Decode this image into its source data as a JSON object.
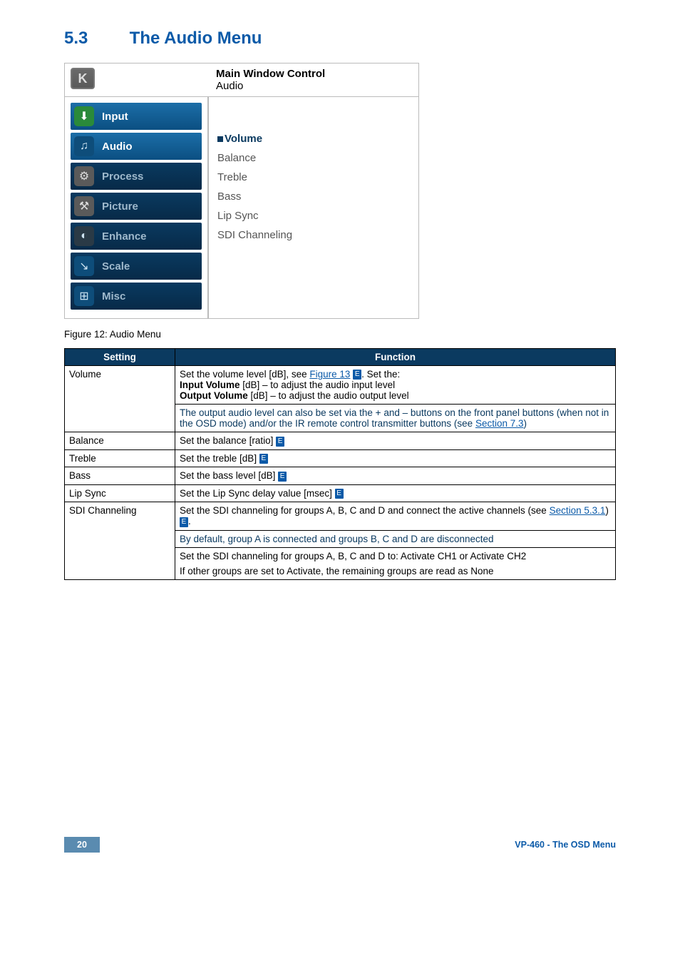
{
  "section": {
    "number": "5.3",
    "title": "The Audio Menu"
  },
  "osd": {
    "header": {
      "line1": "Main Window Control",
      "line2": "Audio"
    },
    "menu": [
      {
        "label": "Input",
        "variant": "light",
        "iconClass": "icon-green",
        "glyph": "⬇",
        "name": "menu-input"
      },
      {
        "label": "Audio",
        "variant": "light",
        "iconClass": "icon-blue",
        "glyph": "♫",
        "name": "menu-audio"
      },
      {
        "label": "Process",
        "variant": "dark",
        "iconClass": "icon-gray",
        "glyph": "⚙",
        "name": "menu-process"
      },
      {
        "label": "Picture",
        "variant": "dark",
        "iconClass": "icon-gray",
        "glyph": "⚒",
        "name": "menu-picture"
      },
      {
        "label": "Enhance",
        "variant": "dark",
        "iconClass": "icon-dark",
        "glyph": "◐",
        "name": "menu-enhance"
      },
      {
        "label": "Scale",
        "variant": "dark",
        "iconClass": "icon-blue",
        "glyph": "↘",
        "name": "menu-scale"
      },
      {
        "label": "Misc",
        "variant": "dark",
        "iconClass": "icon-blue",
        "glyph": "⊞",
        "name": "menu-misc"
      }
    ],
    "content": [
      {
        "label": "Volume",
        "selected": true
      },
      {
        "label": "Balance",
        "selected": false
      },
      {
        "label": "Treble",
        "selected": false
      },
      {
        "label": "Bass",
        "selected": false
      },
      {
        "label": "Lip Sync",
        "selected": false
      },
      {
        "label": "SDI Channeling",
        "selected": false
      }
    ]
  },
  "figure_caption": "Figure 12: Audio Menu",
  "table": {
    "headers": {
      "setting": "Setting",
      "function": "Function"
    },
    "rows": {
      "volume": {
        "setting": "Volume",
        "p1_a": "Set the volume level [dB], see ",
        "p1_link": "Figure 13",
        "p1_b": ". Set the:",
        "p2_bold": "Input Volume",
        "p2_rest": " [dB] – to adjust the audio input level",
        "p3_bold": "Output Volume",
        "p3_rest": " [dB] – to adjust the audio output level",
        "note_a": "The output audio level can also be set via the + and – buttons on the front panel buttons (when not in the OSD mode) and/or the IR remote control transmitter buttons (see ",
        "note_link": "Section 7.3",
        "note_b": ")"
      },
      "balance": {
        "setting": "Balance",
        "func": "Set the balance [ratio] "
      },
      "treble": {
        "setting": "Treble",
        "func": "Set the treble [dB] "
      },
      "bass": {
        "setting": "Bass",
        "func": "Set the bass level [dB] "
      },
      "lipsync": {
        "setting": "Lip Sync",
        "func": "Set the Lip Sync delay value [msec] "
      },
      "sdi": {
        "setting": "SDI Channeling",
        "p1_a": "Set the SDI channeling for groups A, B, C and D and connect the active channels (see ",
        "p1_link": "Section 5.3.1",
        "p1_b": ")",
        "note": "By default, group A is connected and groups B, C and D are disconnected",
        "p2": "Set the SDI channeling for groups A, B, C and D to: Activate CH1 or Activate CH2",
        "p3": "If other groups are set to Activate, the remaining groups are read as None"
      }
    }
  },
  "footer": {
    "page": "20",
    "text": "VP-460 - The OSD Menu"
  }
}
